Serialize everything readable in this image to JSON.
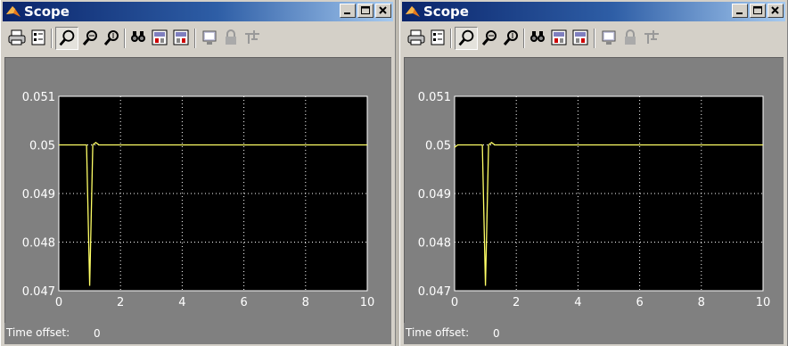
{
  "windows": [
    {
      "title": "Scope",
      "status": {
        "label": "Time offset:",
        "value": "0"
      },
      "toolbar": [
        "print-icon",
        "parameters-icon",
        "zoom-icon",
        "zoom-x-icon",
        "zoom-y-icon",
        "autoscale-icon",
        "save-axes-icon",
        "restore-axes-icon",
        "floating-scope-icon",
        "lock-axes-icon",
        "signal-selector-icon"
      ]
    },
    {
      "title": "Scope",
      "status": {
        "label": "Time offset:",
        "value": "0"
      },
      "toolbar": [
        "print-icon",
        "parameters-icon",
        "zoom-icon",
        "zoom-x-icon",
        "zoom-y-icon",
        "autoscale-icon",
        "save-axes-icon",
        "restore-axes-icon",
        "floating-scope-icon",
        "lock-axes-icon",
        "signal-selector-icon"
      ]
    }
  ],
  "colors": {
    "plot_bg": "#000000",
    "trace": "#ffff66",
    "frame_bg": "#808080",
    "grid": "#ffffff"
  },
  "chart_data": [
    {
      "type": "line",
      "xlim": [
        0,
        10
      ],
      "ylim": [
        0.047,
        0.051
      ],
      "xticks": [
        "0",
        "2",
        "4",
        "6",
        "8",
        "10"
      ],
      "yticks": [
        "0.051",
        "0.05",
        "0.049",
        "0.048",
        "0.047"
      ],
      "grid": true,
      "series": [
        {
          "x": [
            0,
            0.9,
            0.95,
            1.0,
            1.05,
            1.1,
            1.2,
            1.3,
            10
          ],
          "y": [
            0.05,
            0.05,
            0.0485,
            0.0471,
            0.0485,
            0.05,
            0.05005,
            0.05,
            0.05
          ]
        }
      ]
    },
    {
      "type": "line",
      "xlim": [
        0,
        10
      ],
      "ylim": [
        0.047,
        0.051
      ],
      "xticks": [
        "0",
        "2",
        "4",
        "6",
        "8",
        "10"
      ],
      "yticks": [
        "0.051",
        "0.05",
        "0.049",
        "0.048",
        "0.047"
      ],
      "grid": true,
      "series": [
        {
          "x": [
            0,
            0.1,
            0.9,
            0.95,
            1.0,
            1.05,
            1.1,
            1.2,
            1.3,
            10
          ],
          "y": [
            0.04995,
            0.05,
            0.05,
            0.0485,
            0.0471,
            0.0485,
            0.05,
            0.05005,
            0.05,
            0.05
          ]
        }
      ]
    }
  ]
}
